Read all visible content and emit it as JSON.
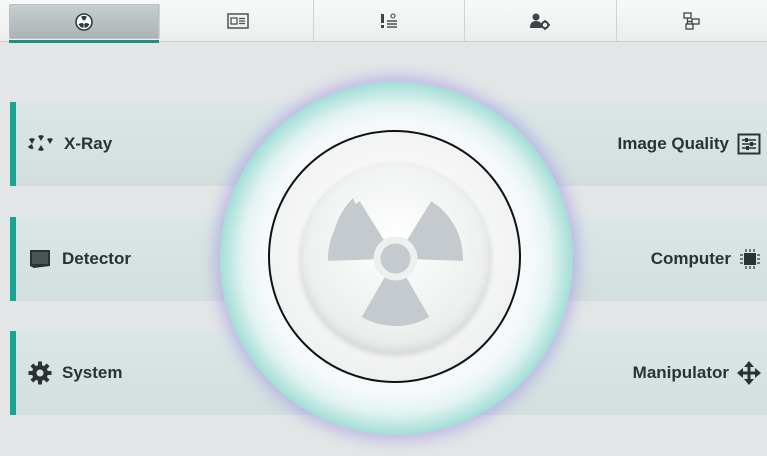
{
  "tabs": [
    {
      "name": "radiation-icon",
      "active": true
    },
    {
      "name": "display-list-icon",
      "active": false
    },
    {
      "name": "alert-list-icon",
      "active": false
    },
    {
      "name": "user-settings-icon",
      "active": false
    },
    {
      "name": "network-icon",
      "active": false
    }
  ],
  "left_panels": [
    {
      "label": "X-Ray",
      "icon": "xray-icon"
    },
    {
      "label": "Detector",
      "icon": "detector-icon"
    },
    {
      "label": "System",
      "icon": "gear-icon"
    }
  ],
  "right_panels": [
    {
      "label": "Image Quality",
      "icon": "image-quality-icon"
    },
    {
      "label": "Computer",
      "icon": "chip-icon"
    },
    {
      "label": "Manipulator",
      "icon": "move-arrows-icon"
    }
  ],
  "colors": {
    "accent": "#1aa493",
    "panel": "#d8e3e3",
    "background": "#e3e6e6",
    "text": "#2b3236"
  },
  "center": {
    "icon": "radiation-trefoil-icon"
  }
}
